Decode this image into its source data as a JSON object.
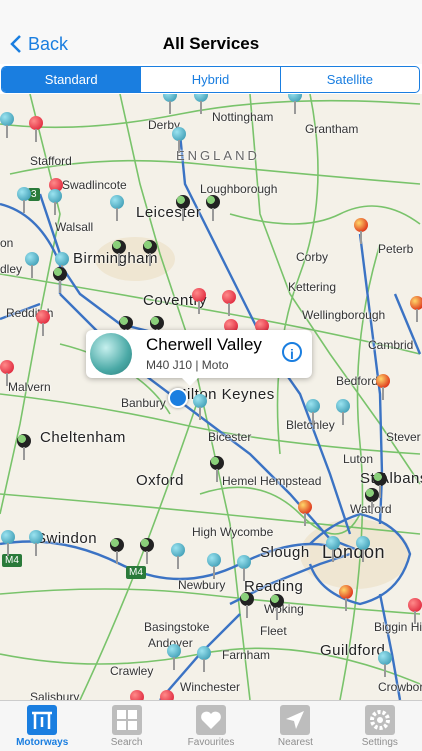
{
  "nav": {
    "back_label": "Back",
    "title": "All Services"
  },
  "segments": [
    "Standard",
    "Hybrid",
    "Satellite"
  ],
  "map": {
    "places": [
      "Derby",
      "Nottingham",
      "Grantham",
      "Stafford",
      "ENGLAND",
      "Loughborough",
      "Swadlincote",
      "Leicester",
      "Walsall",
      "Birmingham",
      "Peterb",
      "Corby",
      "Kettering",
      "Coventry",
      "Redditch",
      "Wellingborough",
      "Cambrid",
      "Malvern",
      "Banbury",
      "Milton Keynes",
      "Bedford",
      "Cheltenham",
      "Bicester",
      "Bletchley",
      "Stever",
      "Luton",
      "Oxford",
      "Hemel Hempstead",
      "St Albans",
      "Watford",
      "High Wycombe",
      "Swindon",
      "Slough",
      "London",
      "Newbury",
      "Reading",
      "Basingstoke",
      "Woking",
      "Andover",
      "Guildford",
      "Fleet",
      "Farnham",
      "Crawley",
      "Winchester",
      "Biggin Hill",
      "Crowboro",
      "Salisbury",
      "on",
      "dley"
    ],
    "road_tags": [
      "M4",
      "M4",
      "3"
    ]
  },
  "callout": {
    "name": "Cherwell Valley",
    "detail": "M40 J10 | Moto",
    "info_icon": "info-icon"
  },
  "tabs": [
    {
      "label": "Motorways",
      "icon": "motorway-icon",
      "active": true
    },
    {
      "label": "Search",
      "icon": "services-sign-icon",
      "active": false
    },
    {
      "label": "Favourites",
      "icon": "heart-icon",
      "active": false
    },
    {
      "label": "Nearest",
      "icon": "location-arrow-icon",
      "active": false
    },
    {
      "label": "Settings",
      "icon": "gear-icon",
      "active": false
    }
  ],
  "colors": {
    "accent": "#1a7ee0",
    "motorway": "#3b73c4",
    "a_road": "#6cbf5e"
  }
}
